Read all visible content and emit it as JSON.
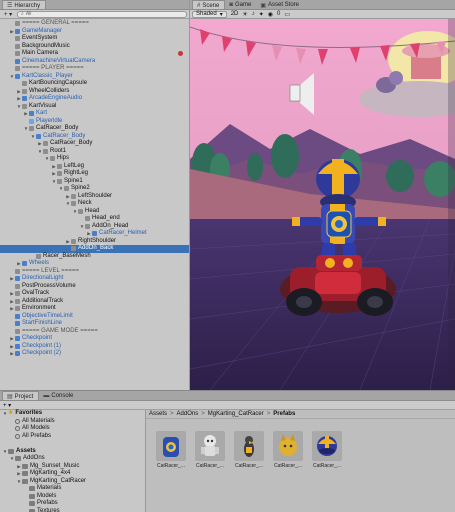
{
  "hierarchy": {
    "tab_label": "Hierarchy",
    "add_label": "+ ▾",
    "search_placeholder": "All",
    "rows": [
      {
        "indent": 0,
        "arrow": "▼",
        "icon": "scene",
        "label": "MainScene*",
        "style": "scene",
        "more": "⋮"
      },
      {
        "indent": 1,
        "arrow": "",
        "icon": "grey",
        "label": "===== GENERAL =====",
        "style": "gray"
      },
      {
        "indent": 1,
        "arrow": "▶",
        "icon": "blue",
        "label": "GameManager",
        "style": "blue"
      },
      {
        "indent": 1,
        "arrow": "",
        "icon": "grey",
        "label": "EventSystem",
        "style": ""
      },
      {
        "indent": 1,
        "arrow": "",
        "icon": "grey",
        "label": "BackgroundMusic",
        "style": ""
      },
      {
        "indent": 1,
        "arrow": "",
        "icon": "grey",
        "label": "Main Camera",
        "style": "",
        "dot": true
      },
      {
        "indent": 1,
        "arrow": "",
        "icon": "blue",
        "label": "CinemachineVirtualCamera",
        "style": "blue"
      },
      {
        "indent": 1,
        "arrow": "",
        "icon": "grey",
        "label": "===== PLAYER =====",
        "style": "gray"
      },
      {
        "indent": 1,
        "arrow": "▼",
        "icon": "blue",
        "label": "KartClassic_Player",
        "style": "blue"
      },
      {
        "indent": 2,
        "arrow": "",
        "icon": "grey",
        "label": "KartBouncingCapsule",
        "style": ""
      },
      {
        "indent": 2,
        "arrow": "▶",
        "icon": "grey",
        "label": "WheelColliders",
        "style": ""
      },
      {
        "indent": 2,
        "arrow": "▶",
        "icon": "blue",
        "label": "ArcadeEngineAudio",
        "style": "blue"
      },
      {
        "indent": 2,
        "arrow": "▼",
        "icon": "grey",
        "label": "KartVisual",
        "style": ""
      },
      {
        "indent": 3,
        "arrow": "▶",
        "icon": "blue",
        "label": "Kart",
        "style": "blue"
      },
      {
        "indent": 3,
        "arrow": "",
        "icon": "lblue",
        "label": "Playerldle",
        "style": "blue"
      },
      {
        "indent": 3,
        "arrow": "▼",
        "icon": "grey",
        "label": "CatRacer_Body",
        "style": ""
      },
      {
        "indent": 4,
        "arrow": "▼",
        "icon": "blue",
        "label": "CatRacer_Body",
        "style": "blue"
      },
      {
        "indent": 5,
        "arrow": "▶",
        "icon": "grey",
        "label": "CatRacer_Body",
        "style": ""
      },
      {
        "indent": 5,
        "arrow": "▼",
        "icon": "grey",
        "label": "Root1",
        "style": ""
      },
      {
        "indent": 6,
        "arrow": "▼",
        "icon": "grey",
        "label": "Hips",
        "style": ""
      },
      {
        "indent": 7,
        "arrow": "▶",
        "icon": "grey",
        "label": "LeftLeg",
        "style": ""
      },
      {
        "indent": 7,
        "arrow": "▶",
        "icon": "grey",
        "label": "RightLeg",
        "style": ""
      },
      {
        "indent": 7,
        "arrow": "▼",
        "icon": "grey",
        "label": "Spine1",
        "style": ""
      },
      {
        "indent": 8,
        "arrow": "▼",
        "icon": "grey",
        "label": "Spine2",
        "style": ""
      },
      {
        "indent": 9,
        "arrow": "▶",
        "icon": "grey",
        "label": "LeftShoulder",
        "style": ""
      },
      {
        "indent": 9,
        "arrow": "▼",
        "icon": "grey",
        "label": "Neck",
        "style": ""
      },
      {
        "indent": 10,
        "arrow": "▼",
        "icon": "grey",
        "label": "Head",
        "style": ""
      },
      {
        "indent": 11,
        "arrow": "",
        "icon": "grey",
        "label": "Head_end",
        "style": ""
      },
      {
        "indent": 11,
        "arrow": "▼",
        "icon": "grey",
        "label": "AddOn_Head",
        "style": ""
      },
      {
        "indent": 12,
        "arrow": "▶",
        "icon": "blue",
        "label": "CatRacer_Helmet",
        "style": "blue"
      },
      {
        "indent": 9,
        "arrow": "▶",
        "icon": "grey",
        "label": "RightShoulder",
        "style": ""
      },
      {
        "indent": 9,
        "arrow": "",
        "icon": "grey",
        "label": "AddOn_Back",
        "style": "",
        "selected": true
      },
      {
        "indent": 4,
        "arrow": "",
        "icon": "grey",
        "label": "Racer_BaseMesh",
        "style": ""
      },
      {
        "indent": 2,
        "arrow": "▶",
        "icon": "blue",
        "label": "Wheels",
        "style": "blue"
      },
      {
        "indent": 1,
        "arrow": "",
        "icon": "grey",
        "label": "===== LEVEL =====",
        "style": "gray"
      },
      {
        "indent": 1,
        "arrow": "▶",
        "icon": "blue",
        "label": "DirectionalLight",
        "style": "blue"
      },
      {
        "indent": 1,
        "arrow": "",
        "icon": "grey",
        "label": "PostProcessVolume",
        "style": ""
      },
      {
        "indent": 1,
        "arrow": "▶",
        "icon": "grey",
        "label": "OvalTrack",
        "style": ""
      },
      {
        "indent": 1,
        "arrow": "▶",
        "icon": "grey",
        "label": "AdditionalTrack",
        "style": ""
      },
      {
        "indent": 1,
        "arrow": "▶",
        "icon": "grey",
        "label": "Environment",
        "style": ""
      },
      {
        "indent": 1,
        "arrow": "",
        "icon": "blue",
        "label": "ObjectiveTimeLimit",
        "style": "blue"
      },
      {
        "indent": 1,
        "arrow": "",
        "icon": "blue",
        "label": "StartFinishLine",
        "style": "blue"
      },
      {
        "indent": 1,
        "arrow": "",
        "icon": "grey",
        "label": "===== GAME MODE =====",
        "style": "gray"
      },
      {
        "indent": 1,
        "arrow": "▶",
        "icon": "blue",
        "label": "Checkpoint",
        "style": "blue"
      },
      {
        "indent": 1,
        "arrow": "▶",
        "icon": "blue",
        "label": "Checkpoint (1)",
        "style": "blue"
      },
      {
        "indent": 1,
        "arrow": "▶",
        "icon": "blue",
        "label": "Checkpoint (2)",
        "style": "blue"
      }
    ]
  },
  "scene": {
    "tabs": [
      "Scene",
      "Game",
      "Asset Store"
    ],
    "shading_mode": "Shaded",
    "mode_2d": "2D",
    "gizmo_count": "0"
  },
  "project": {
    "tabs": [
      "Project",
      "Console"
    ],
    "add_label": "+ ▾",
    "tree": [
      {
        "indent": 0,
        "arrow": "▼",
        "icon": "star",
        "label": "Favorites",
        "bold": true
      },
      {
        "indent": 1,
        "arrow": "",
        "icon": "search",
        "label": "All Materials"
      },
      {
        "indent": 1,
        "arrow": "",
        "icon": "search",
        "label": "All Models"
      },
      {
        "indent": 1,
        "arrow": "",
        "icon": "search",
        "label": "All Prefabs"
      },
      {
        "indent": 0,
        "arrow": "",
        "icon": "none",
        "label": ""
      },
      {
        "indent": 0,
        "arrow": "▼",
        "icon": "folder",
        "label": "Assets",
        "bold": true
      },
      {
        "indent": 1,
        "arrow": "▼",
        "icon": "folder",
        "label": "AddOns"
      },
      {
        "indent": 2,
        "arrow": "▶",
        "icon": "folder",
        "label": "Mg_Sunset_Music"
      },
      {
        "indent": 2,
        "arrow": "▶",
        "icon": "folder",
        "label": "MgKarting_4x4"
      },
      {
        "indent": 2,
        "arrow": "▼",
        "icon": "folder",
        "label": "MgKarting_CatRacer"
      },
      {
        "indent": 3,
        "arrow": "",
        "icon": "folder",
        "label": "Materials"
      },
      {
        "indent": 3,
        "arrow": "",
        "icon": "folder",
        "label": "Models"
      },
      {
        "indent": 3,
        "arrow": "",
        "icon": "folder",
        "label": "Prefabs"
      },
      {
        "indent": 3,
        "arrow": "",
        "icon": "folder",
        "label": "Textures"
      }
    ],
    "breadcrumb": [
      "Assets",
      "AddOns",
      "MgKarting_CatRacer",
      "Prefabs"
    ],
    "assets": [
      {
        "label": "CatRacer_...",
        "thumb": "backpack"
      },
      {
        "label": "CatRacer_...",
        "thumb": "robot"
      },
      {
        "label": "CatRacer_...",
        "thumb": "bird"
      },
      {
        "label": "CatRacer_...",
        "thumb": "cat"
      },
      {
        "label": "CatRacer_...",
        "thumb": "helmet"
      }
    ]
  },
  "colors": {
    "selection": "#3a72b8",
    "prefab_blue": "#2a5fb0",
    "sky_pink": "#e9a6c9",
    "flag_red": "#e0406e"
  }
}
